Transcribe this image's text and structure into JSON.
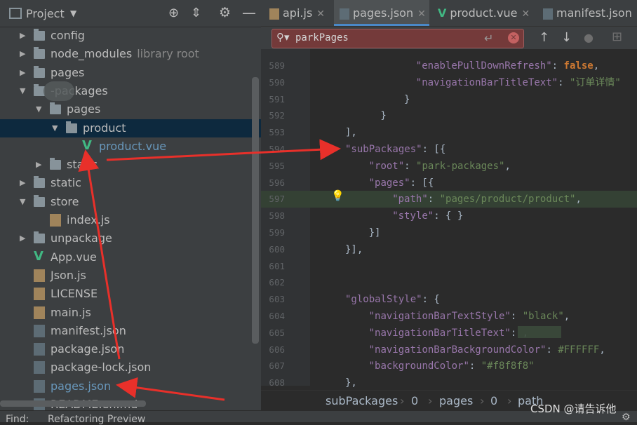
{
  "project_panel": {
    "title": "Project",
    "tree": [
      {
        "label": "config",
        "type": "folder",
        "depth": 0,
        "expanded": false
      },
      {
        "label": "node_modules",
        "suffix": "library root",
        "type": "folder",
        "depth": 0,
        "expanded": false
      },
      {
        "label": "pages",
        "type": "folder",
        "depth": 0,
        "expanded": false
      },
      {
        "label": "-packages",
        "type": "folder",
        "depth": 0,
        "expanded": true
      },
      {
        "label": "pages",
        "type": "folder",
        "depth": 1,
        "expanded": true
      },
      {
        "label": "product",
        "type": "folder",
        "depth": 2,
        "expanded": true,
        "selected": true
      },
      {
        "label": "product.vue",
        "type": "vue",
        "depth": 3
      },
      {
        "label": "static",
        "type": "folder",
        "depth": 1,
        "expanded": false
      },
      {
        "label": "static",
        "type": "folder",
        "depth": 0,
        "expanded": false
      },
      {
        "label": "store",
        "type": "folder",
        "depth": 0,
        "expanded": true
      },
      {
        "label": "index.js",
        "type": "js",
        "depth": 1
      },
      {
        "label": "unpackage",
        "type": "folder",
        "depth": 0,
        "expanded": false
      },
      {
        "label": "App.vue",
        "type": "vue",
        "depth": 0
      },
      {
        "label": "Json.js",
        "type": "js",
        "depth": 0
      },
      {
        "label": "LICENSE",
        "type": "js",
        "depth": 0
      },
      {
        "label": "main.js",
        "type": "js",
        "depth": 0
      },
      {
        "label": "manifest.json",
        "type": "json",
        "depth": 0
      },
      {
        "label": "package.json",
        "type": "json",
        "depth": 0
      },
      {
        "label": "package-lock.json",
        "type": "json",
        "depth": 0
      },
      {
        "label": "pages.json",
        "type": "json",
        "depth": 0,
        "highlight": true
      },
      {
        "label": "README.en.md",
        "type": "json",
        "depth": 0
      }
    ]
  },
  "editor_tabs": [
    {
      "label": "api.js",
      "icon": "js-file-icon"
    },
    {
      "label": "pages.json",
      "icon": "json-file-icon",
      "active": true
    },
    {
      "label": "product.vue",
      "icon": "vue-file-icon"
    },
    {
      "label": "manifest.json",
      "icon": "json-file-icon"
    }
  ],
  "search": {
    "value": "parkPages"
  },
  "code_lines": [
    {
      "n": "589",
      "indent": 12,
      "key": "\"enablePullDownRefresh\"",
      "rest": ": ",
      "kw": "false",
      "end": ","
    },
    {
      "n": "590",
      "indent": 12,
      "key": "\"navigationBarTitleText\"",
      "rest": ": ",
      "str": "\"订单详情\""
    },
    {
      "n": "591",
      "indent": 10,
      "pun": "}"
    },
    {
      "n": "592",
      "indent": 6,
      "pun": "}"
    },
    {
      "n": "593",
      "indent": 0,
      "pun": "],"
    },
    {
      "n": "594",
      "indent": 0,
      "key": "\"subPackages\"",
      "rest": ": [{"
    },
    {
      "n": "595",
      "indent": 4,
      "key": "\"root\"",
      "rest": ": ",
      "str": "\"park-packages\"",
      "end": ","
    },
    {
      "n": "596",
      "indent": 4,
      "key": "\"pages\"",
      "rest": ": [{"
    },
    {
      "n": "597",
      "indent": 8,
      "key": "\"path\"",
      "rest": ": ",
      "str": "\"pages/product/product\"",
      "end": ",",
      "current": true
    },
    {
      "n": "598",
      "indent": 8,
      "key": "\"style\"",
      "rest": ": { }"
    },
    {
      "n": "599",
      "indent": 4,
      "pun": "}]"
    },
    {
      "n": "600",
      "indent": 0,
      "pun": "}],"
    },
    {
      "n": "601",
      "indent": 0,
      "pun": ""
    },
    {
      "n": "602",
      "indent": 0,
      "pun": ""
    },
    {
      "n": "603",
      "indent": 0,
      "key": "\"globalStyle\"",
      "rest": ": {"
    },
    {
      "n": "604",
      "indent": 4,
      "key": "\"navigationBarTextStyle\"",
      "rest": ": ",
      "str": "\"black\"",
      "end": ","
    },
    {
      "n": "605",
      "indent": 4,
      "key": "\"navigationBarTitleText\"",
      "rest": ": ",
      "str": "",
      "end": ","
    },
    {
      "n": "606",
      "indent": 4,
      "key": "\"navigationBarBackgroundColor\"",
      "rest": ": ",
      "str": "#FFFFFF",
      "end": ","
    },
    {
      "n": "607",
      "indent": 4,
      "key": "\"backgroundColor\"",
      "rest": ": ",
      "str": "\"#f8f8f8\""
    },
    {
      "n": "608",
      "indent": 0,
      "pun": "},"
    }
  ],
  "breadcrumbs": [
    "subPackages",
    "0",
    "pages",
    "0",
    "path"
  ],
  "find_bar": {
    "find_label": "Find:",
    "tab_label": "Refactoring Preview"
  },
  "watermark": "CSDN @请告诉他",
  "colors": {
    "accent": "#4a88c7",
    "arrow": "#e8302a",
    "selection": "#0d293e"
  }
}
